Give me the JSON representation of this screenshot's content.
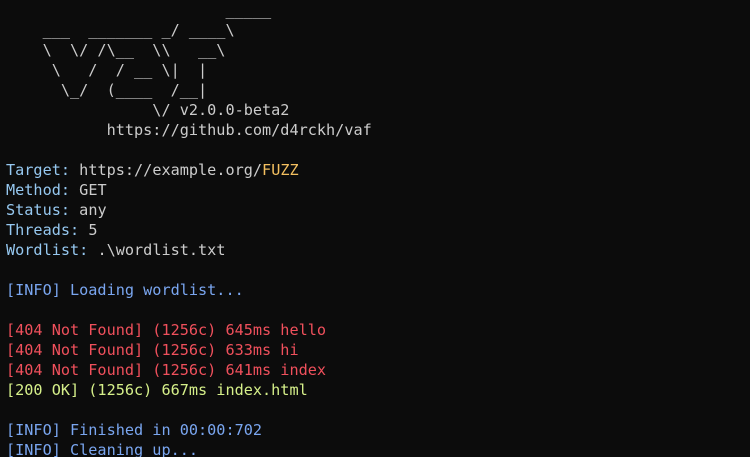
{
  "banner": {
    "lines": [
      "                        _____",
      "    ___  _______ _/ ____\\",
      "    \\  \\/ /\\__  \\\\   __\\",
      "     \\   /  / __ \\|  |",
      "      \\_/  (____  /__|",
      "                \\/ v2.0.0-beta2",
      "           https://github.com/d4rckh/vaf"
    ]
  },
  "config": {
    "target_label": "Target:",
    "target_prefix": "https://example.org/",
    "target_fuzz": "FUZZ",
    "method_label": "Method:",
    "method_value": "GET",
    "status_label": "Status:",
    "status_value": "any",
    "threads_label": "Threads:",
    "threads_value": "5",
    "wordlist_label": "Wordlist:",
    "wordlist_value": ".\\wordlist.txt"
  },
  "log": {
    "loading": "[INFO] Loading wordlist...",
    "results": [
      {
        "text": "[404 Not Found] (1256c) 645ms hello",
        "status": "error"
      },
      {
        "text": "[404 Not Found] (1256c) 633ms hi",
        "status": "error"
      },
      {
        "text": "[404 Not Found] (1256c) 641ms index",
        "status": "error"
      },
      {
        "text": "[200 OK] (1256c) 667ms index.html",
        "status": "ok"
      }
    ],
    "finished": "[INFO] Finished in 00:00:702",
    "cleaning": "[INFO] Cleaning up..."
  },
  "colors": {
    "background": "#0c0c0c",
    "text": "#cccccc",
    "label": "#96c8f0",
    "fuzz": "#f4c060",
    "info": "#7aa6f0",
    "error": "#f0505c",
    "ok": "#d6f08a"
  }
}
